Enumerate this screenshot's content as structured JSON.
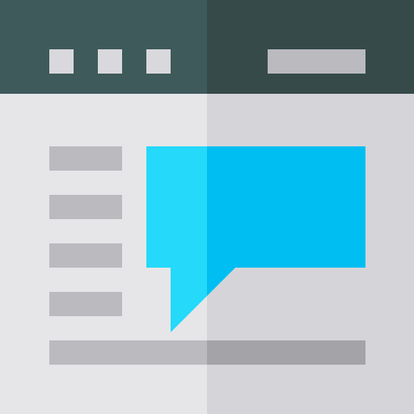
{
  "icon": {
    "name": "browser-chat-window-icon",
    "colors": {
      "titlebar_left": "#3f5a5b",
      "titlebar_right": "#364a4a",
      "page_left": "#e6e6e8",
      "page_right": "#d5d5d9",
      "dot": "#d9d9dd",
      "bar_left": "#bababf",
      "bar_right": "#a3a3a8",
      "bubble_left": "#24d9f9",
      "bubble_right": "#00bef1"
    }
  }
}
